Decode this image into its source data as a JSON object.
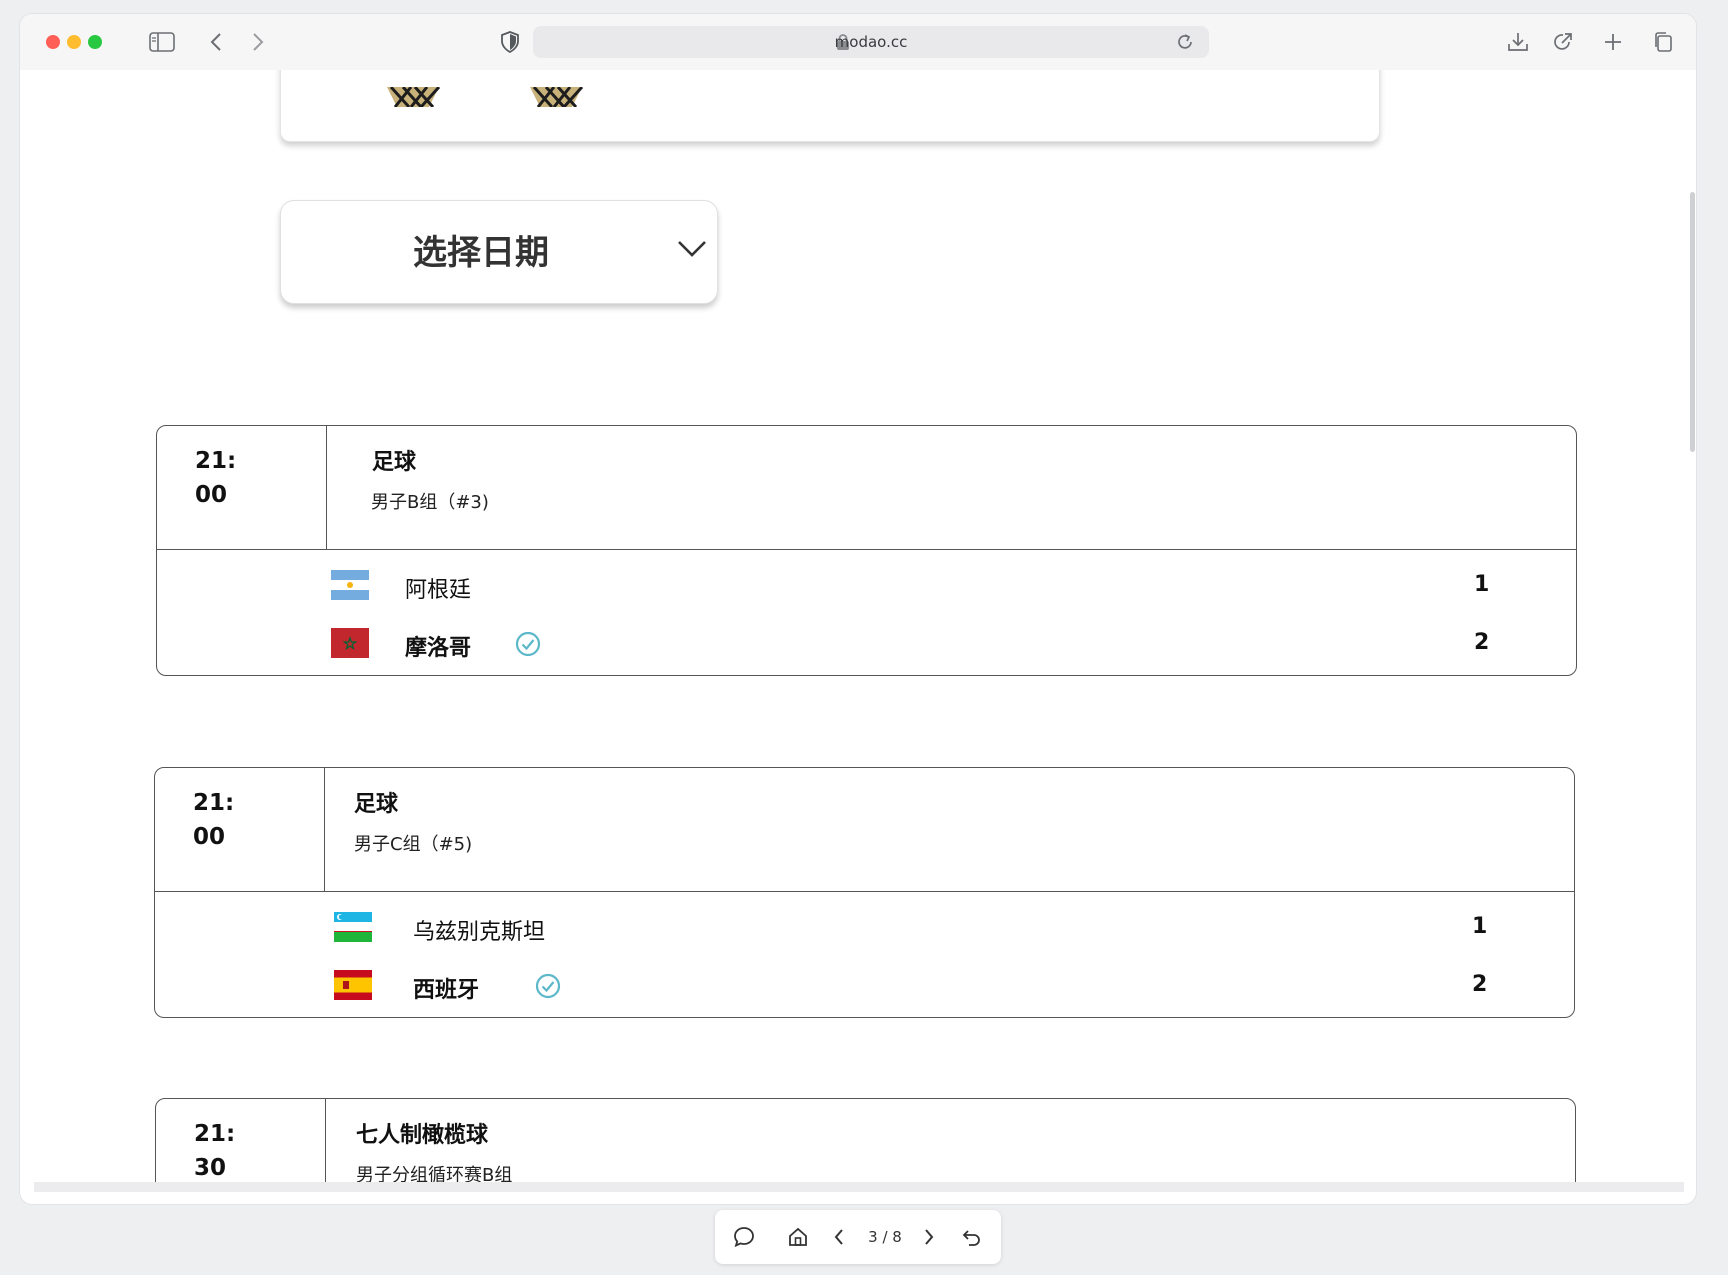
{
  "browser": {
    "url": "modao.cc",
    "icons": [
      "sidebar-icon",
      "back-icon",
      "forward-icon",
      "shield-icon",
      "lock-icon",
      "reload-icon",
      "download-icon",
      "share-icon",
      "new-tab-icon",
      "tabs-icon"
    ]
  },
  "date_picker": {
    "label": "选择日期"
  },
  "matches": [
    {
      "time_line1": "21:",
      "time_line2": "00",
      "sport": "足球",
      "stage": "男子B组（#3)",
      "teams": [
        {
          "name": "阿根廷",
          "score": "1",
          "flag": "argentina",
          "winner": false
        },
        {
          "name": "摩洛哥",
          "score": "2",
          "flag": "morocco",
          "winner": true
        }
      ]
    },
    {
      "time_line1": "21:",
      "time_line2": "00",
      "sport": "足球",
      "stage": "男子C组（#5)",
      "teams": [
        {
          "name": "乌兹别克斯坦",
          "score": "1",
          "flag": "uzbekistan",
          "winner": false
        },
        {
          "name": "西班牙",
          "score": "2",
          "flag": "spain",
          "winner": true
        }
      ]
    },
    {
      "time_line1": "21:",
      "time_line2": "30",
      "sport": "七人制橄榄球",
      "stage": "男子分组循环赛B组"
    }
  ],
  "bottom_bar": {
    "page_indicator": "3 / 8"
  },
  "colors": {
    "check": "#5bb7c9",
    "accent_red": "#ff5f57",
    "accent_yellow": "#febc2e",
    "accent_green": "#28c840"
  }
}
